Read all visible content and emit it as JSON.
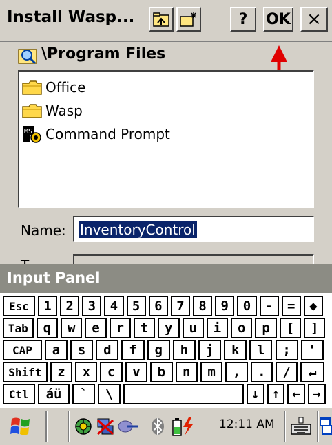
{
  "window": {
    "title": "Install Wasp...",
    "help_label": "?",
    "ok_label": "OK",
    "close_label": "×"
  },
  "location": {
    "path": "\\Program Files"
  },
  "files": [
    {
      "label": "Office",
      "icon": "folder-icon"
    },
    {
      "label": "Wasp",
      "icon": "folder-icon"
    },
    {
      "label": "Command Prompt",
      "icon": "command-prompt-icon"
    }
  ],
  "form": {
    "name_label": "Name:",
    "name_value": "InventoryControl",
    "type_label": "T"
  },
  "input_panel": {
    "title": "Input Panel"
  },
  "keyboard": {
    "rows": [
      [
        "Esc",
        "1",
        "2",
        "3",
        "4",
        "5",
        "6",
        "7",
        "8",
        "9",
        "0",
        "-",
        "=",
        "◆"
      ],
      [
        "Tab",
        "q",
        "w",
        "e",
        "r",
        "t",
        "y",
        "u",
        "i",
        "o",
        "p",
        "[",
        "]"
      ],
      [
        "CAP",
        "a",
        "s",
        "d",
        "f",
        "g",
        "h",
        "j",
        "k",
        "l",
        ";",
        "'"
      ],
      [
        "Shift",
        "z",
        "x",
        "c",
        "v",
        "b",
        "n",
        "m",
        ",",
        ".",
        "/",
        "↵"
      ],
      [
        "Ctl",
        "áü",
        "`",
        "\\",
        "",
        "↓",
        "↑",
        "←",
        "→"
      ]
    ]
  },
  "taskbar": {
    "clock": "12:11 AM",
    "icons": [
      "start-icon",
      "network-icon",
      "connection-icon",
      "sync-icon",
      "bluetooth-icon",
      "battery-icon",
      "keyboard-icon",
      "switch-window-icon"
    ]
  },
  "colors": {
    "selection": "#0a246a",
    "arrow": "#e00000",
    "panel_header": "#8c8c84"
  }
}
